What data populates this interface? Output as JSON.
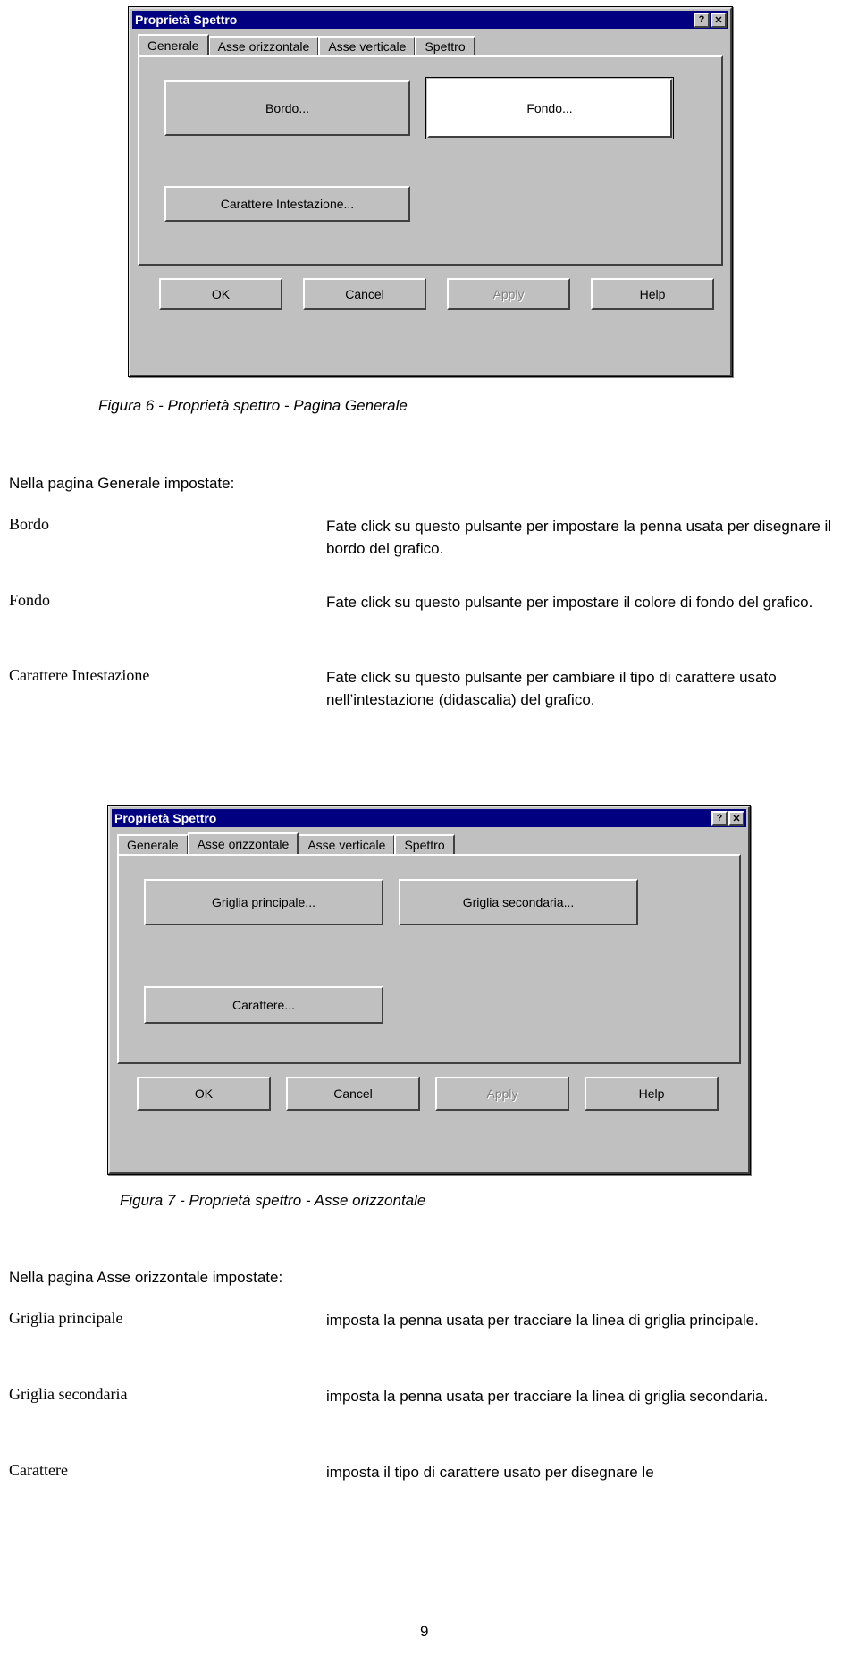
{
  "document": {
    "page_number": "9"
  },
  "dialog1": {
    "title": "Proprietà Spettro",
    "help_button": "?",
    "close_button": "✕",
    "tabs": [
      {
        "label": "Generale",
        "active": true
      },
      {
        "label": "Asse orizzontale",
        "active": false
      },
      {
        "label": "Asse verticale",
        "active": false
      },
      {
        "label": "Spettro",
        "active": false
      }
    ],
    "buttons": {
      "bordo": "Bordo...",
      "fondo": "Fondo...",
      "carattere_intestazione": "Carattere Intestazione...",
      "ok": "OK",
      "cancel": "Cancel",
      "apply": "Apply",
      "help": "Help"
    }
  },
  "figura6_caption": "Figura 6 - Proprietà spettro - Pagina Generale",
  "section1": {
    "intro": "Nella pagina Generale impostate:",
    "rows": [
      {
        "term": "Bordo",
        "desc": "Fate click su questo pulsante per impostare la penna usata per disegnare il bordo del grafico."
      },
      {
        "term": "Fondo",
        "desc": "Fate click su questo pulsante per impostare il colore di fondo del grafico."
      },
      {
        "term": "Carattere Intestazione",
        "desc": "Fate click su questo pulsante per cambiare il tipo di carattere usato nell’intestazione (didascalia) del grafico."
      }
    ]
  },
  "dialog2": {
    "title": "Proprietà Spettro",
    "help_button": "?",
    "close_button": "✕",
    "tabs": [
      {
        "label": "Generale",
        "active": false
      },
      {
        "label": "Asse orizzontale",
        "active": true
      },
      {
        "label": "Asse verticale",
        "active": false
      },
      {
        "label": "Spettro",
        "active": false
      }
    ],
    "buttons": {
      "griglia_principale": "Griglia principale...",
      "griglia_secondaria": "Griglia secondaria...",
      "carattere": "Carattere...",
      "ok": "OK",
      "cancel": "Cancel",
      "apply": "Apply",
      "help": "Help"
    }
  },
  "figura7_caption": "Figura 7 - Proprietà spettro - Asse orizzontale",
  "section2": {
    "intro": "Nella pagina Asse orizzontale impostate:",
    "rows": [
      {
        "term": "Griglia principale",
        "desc": "imposta la penna usata per tracciare la linea di griglia principale."
      },
      {
        "term": "Griglia secondaria",
        "desc": "imposta la penna usata per tracciare la linea di griglia secondaria."
      },
      {
        "term": "Carattere",
        "desc": "imposta il tipo di carattere usato per disegnare le"
      }
    ]
  }
}
